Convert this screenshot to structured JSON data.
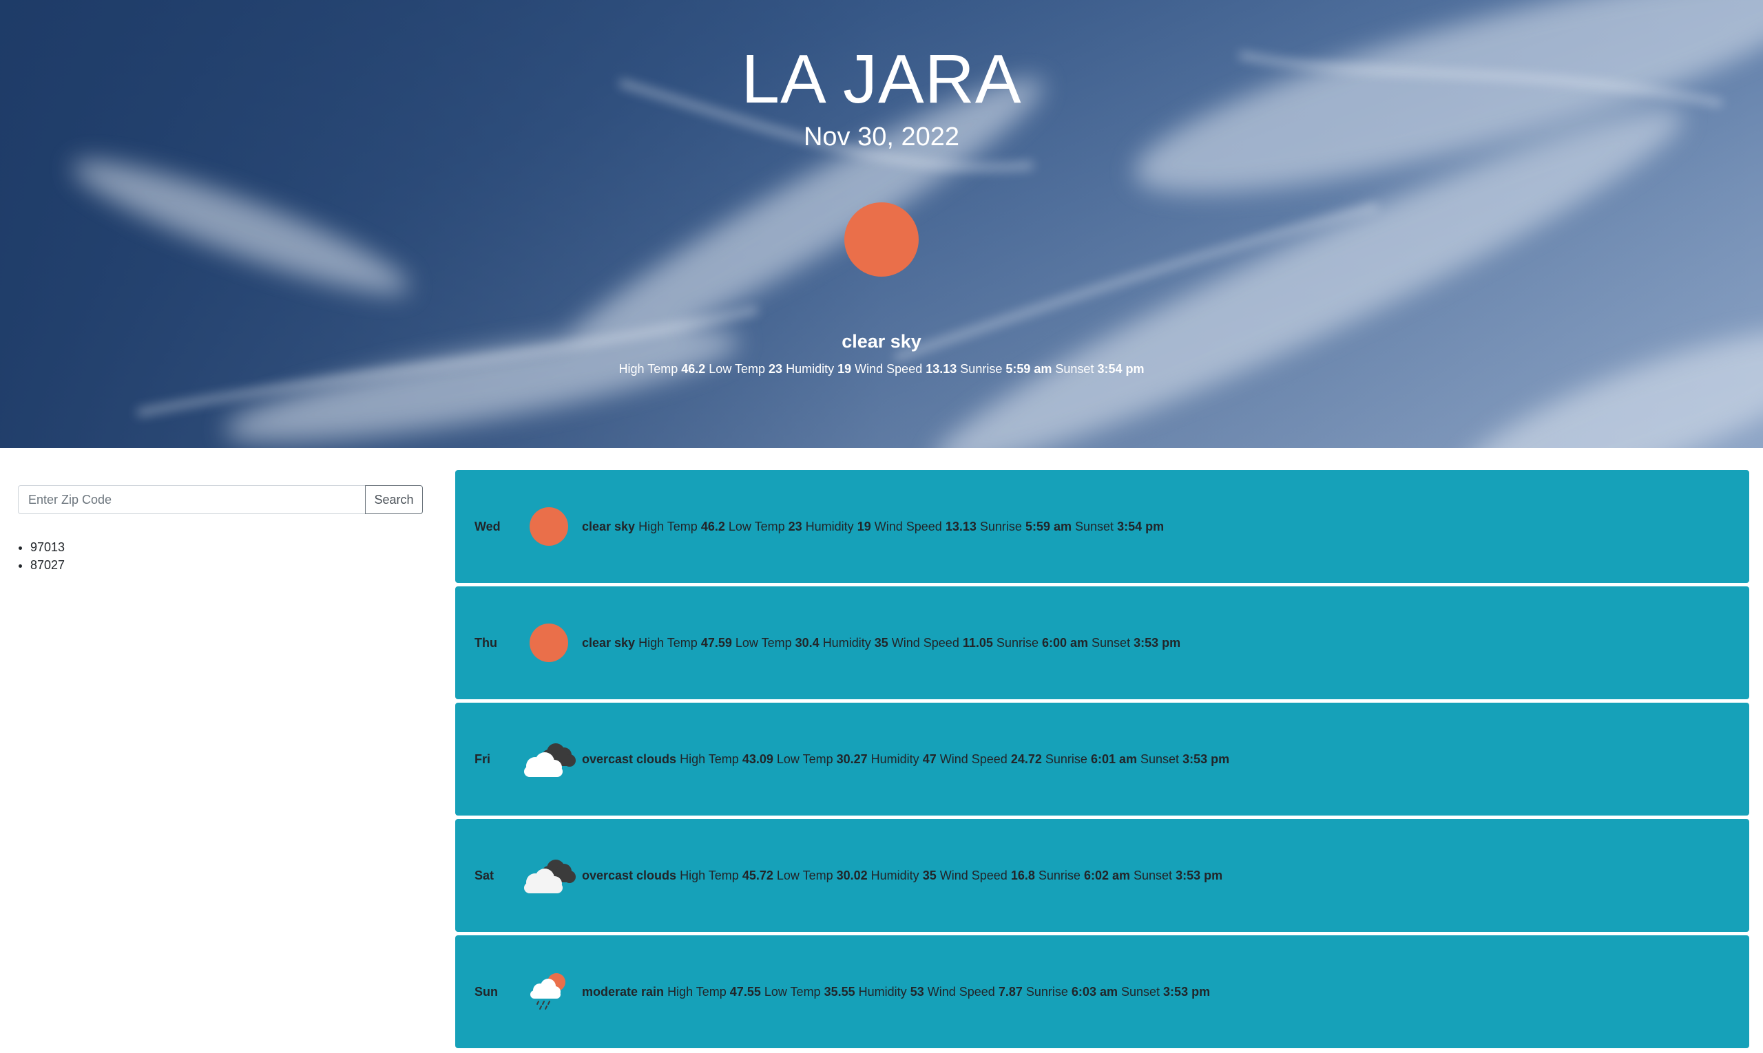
{
  "hero": {
    "city": "LA JARA",
    "date": "Nov 30, 2022",
    "icon": "sun-icon",
    "description": "clear sky",
    "stats": [
      {
        "label": "High Temp",
        "value": "46.2"
      },
      {
        "label": "Low Temp",
        "value": "23"
      },
      {
        "label": "Humidity",
        "value": "19"
      },
      {
        "label": "Wind Speed",
        "value": "13.13"
      },
      {
        "label": "Sunrise",
        "value": "5:59 am"
      },
      {
        "label": "Sunset",
        "value": "3:54 pm"
      }
    ]
  },
  "search": {
    "placeholder": "Enter Zip Code",
    "button_label": "Search",
    "saved_zips": [
      "97013",
      "87027"
    ]
  },
  "forecast": [
    {
      "day": "Wed",
      "icon": "sun-icon",
      "description": "clear sky",
      "high": "46.2",
      "low": "23",
      "humidity": "19",
      "wind": "13.13",
      "sunrise": "5:59 am",
      "sunset": "3:54 pm"
    },
    {
      "day": "Thu",
      "icon": "sun-icon",
      "description": "clear sky",
      "high": "47.59",
      "low": "30.4",
      "humidity": "35",
      "wind": "11.05",
      "sunrise": "6:00 am",
      "sunset": "3:53 pm"
    },
    {
      "day": "Fri",
      "icon": "overcast-clouds-icon",
      "description": "overcast clouds",
      "high": "43.09",
      "low": "30.27",
      "humidity": "47",
      "wind": "24.72",
      "sunrise": "6:01 am",
      "sunset": "3:53 pm"
    },
    {
      "day": "Sat",
      "icon": "overcast-clouds-icon",
      "description": "overcast clouds",
      "high": "45.72",
      "low": "30.02",
      "humidity": "35",
      "wind": "16.8",
      "sunrise": "6:02 am",
      "sunset": "3:53 pm"
    },
    {
      "day": "Sun",
      "icon": "rain-icon",
      "description": "moderate rain",
      "high": "47.55",
      "low": "35.55",
      "humidity": "53",
      "wind": "7.87",
      "sunrise": "6:03 am",
      "sunset": "3:53 pm"
    }
  ],
  "labels": {
    "high": "High Temp",
    "low": "Low Temp",
    "humidity": "Humidity",
    "wind": "Wind Speed",
    "sunrise": "Sunrise",
    "sunset": "Sunset"
  },
  "colors": {
    "accent": "#16a1b9",
    "sun": "#ea6f4a",
    "sky": "#3d5f8f"
  }
}
